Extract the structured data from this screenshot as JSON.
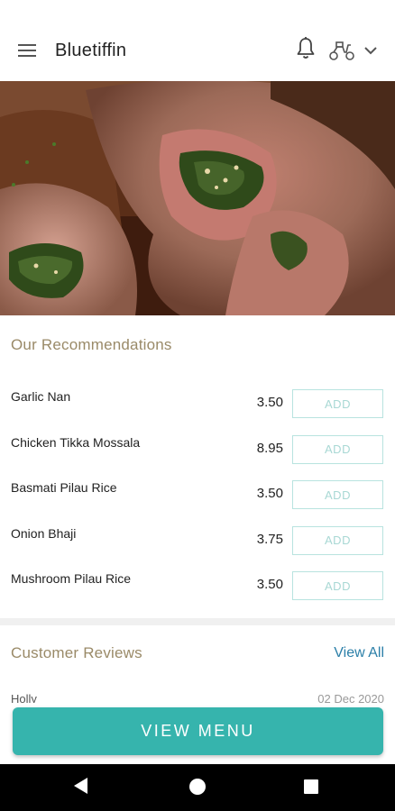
{
  "header": {
    "title": "Bluetiffin",
    "icons": [
      "menu-icon",
      "bell-icon",
      "scooter-icon",
      "chevron-down-icon"
    ]
  },
  "hero": {
    "image": "roast-lamb-stuffed-with-spinach"
  },
  "recommendations": {
    "title": "Our Recommendations",
    "add_label": "ADD",
    "items": [
      {
        "name": "Garlic Nan",
        "price": "3.50"
      },
      {
        "name": "Chicken Tikka Mossala",
        "price": "8.95"
      },
      {
        "name": "Basmati Pilau Rice",
        "price": "3.50"
      },
      {
        "name": "Onion Bhaji",
        "price": "3.75"
      },
      {
        "name": "Mushroom Pilau Rice",
        "price": "3.50"
      }
    ]
  },
  "reviews": {
    "title": "Customer Reviews",
    "view_all": "View All",
    "first": {
      "name": "Holly",
      "date": "02 Dec 2020"
    }
  },
  "cta": {
    "label": "VIEW MENU"
  },
  "colors": {
    "accent": "#36b4ad",
    "section_title": "#9a8a68",
    "link": "#2b7fa8"
  }
}
